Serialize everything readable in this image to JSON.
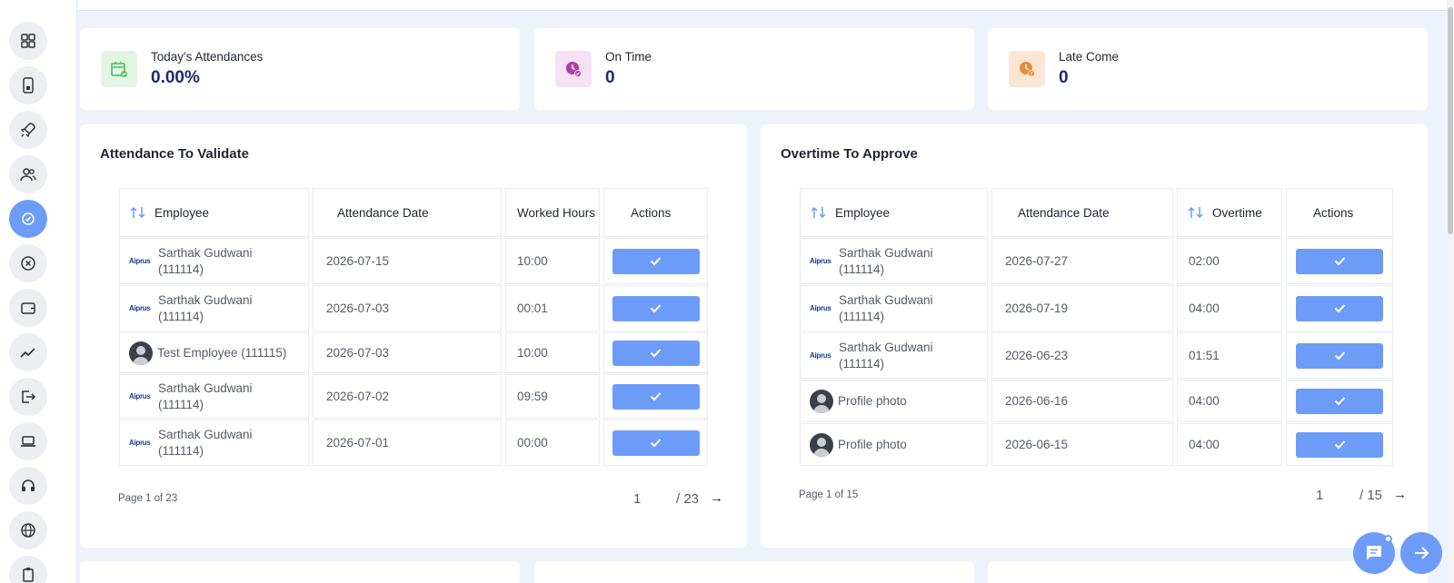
{
  "stats": [
    {
      "title": "Today's Attendances",
      "value": "0.00%",
      "icon": "calendar-check-icon",
      "bg": "#e3f5e5",
      "color": "#58c26a"
    },
    {
      "title": "On Time",
      "value": "0",
      "icon": "clock-check-icon",
      "bg": "#f6e0f4",
      "color": "#b33aa7"
    },
    {
      "title": "Late Come",
      "value": "0",
      "icon": "clock-alert-icon",
      "bg": "#fbe6d4",
      "color": "#e88a3a"
    }
  ],
  "attendance": {
    "title": "Attendance To Validate",
    "headers": {
      "employee": "Employee",
      "date": "Attendance Date",
      "hours": "Worked Hours",
      "actions": "Actions"
    },
    "logo_text": "Aiprus",
    "rows": [
      {
        "name": "Sarthak Gudwani\n(111114)",
        "avatar": "logo",
        "date": "2026-07-15",
        "hours": "10:00"
      },
      {
        "name": "Sarthak Gudwani\n(111114)",
        "avatar": "logo",
        "date": "2026-07-03",
        "hours": "00:01"
      },
      {
        "name": "Test Employee (111115)",
        "avatar": "photo",
        "date": "2026-07-03",
        "hours": "10:00"
      },
      {
        "name": "Sarthak Gudwani\n(111114)",
        "avatar": "logo",
        "date": "2026-07-02",
        "hours": "09:59"
      },
      {
        "name": "Sarthak Gudwani\n(111114)",
        "avatar": "logo",
        "date": "2026-07-01",
        "hours": "00:00"
      }
    ],
    "pagination": {
      "label": "Page 1 of 23",
      "current": "1",
      "total": "/ 23",
      "next": "→"
    }
  },
  "overtime": {
    "title": "Overtime To Approve",
    "headers": {
      "employee": "Employee",
      "date": "Attendance Date",
      "overtime": "Overtime",
      "actions": "Actions"
    },
    "logo_text": "Aiprus",
    "rows": [
      {
        "name": "Sarthak Gudwani\n(111114)",
        "avatar": "logo",
        "date": "2026-07-27",
        "overtime": "02:00"
      },
      {
        "name": "Sarthak Gudwani\n(111114)",
        "avatar": "logo",
        "date": "2026-07-19",
        "overtime": "04:00"
      },
      {
        "name": "Sarthak Gudwani\n(111114)",
        "avatar": "logo",
        "date": "2026-06-23",
        "overtime": "01:51"
      },
      {
        "name": "Profile photo",
        "avatar": "photo",
        "date": "2026-06-16",
        "overtime": "04:00"
      },
      {
        "name": "Profile photo",
        "avatar": "photo",
        "date": "2026-06-15",
        "overtime": "04:00"
      }
    ],
    "pagination": {
      "label": "Page 1 of 15",
      "current": "1",
      "total": "/ 15",
      "next": "→"
    }
  },
  "sidebar": {
    "items": [
      {
        "icon": "dashboard-grid-icon"
      },
      {
        "icon": "tablet-icon"
      },
      {
        "icon": "rocket-icon"
      },
      {
        "icon": "users-icon"
      },
      {
        "icon": "attendance-icon",
        "active": true
      },
      {
        "icon": "close-circle-icon"
      },
      {
        "icon": "wallet-icon"
      },
      {
        "icon": "trend-chart-icon"
      },
      {
        "icon": "logout-icon"
      },
      {
        "icon": "laptop-icon"
      },
      {
        "icon": "headset-icon"
      },
      {
        "icon": "globe-icon"
      },
      {
        "icon": "clipboard-icon"
      }
    ]
  },
  "fab": {
    "chat_icon": "chat-icon",
    "next_icon": "arrow-right-icon"
  }
}
